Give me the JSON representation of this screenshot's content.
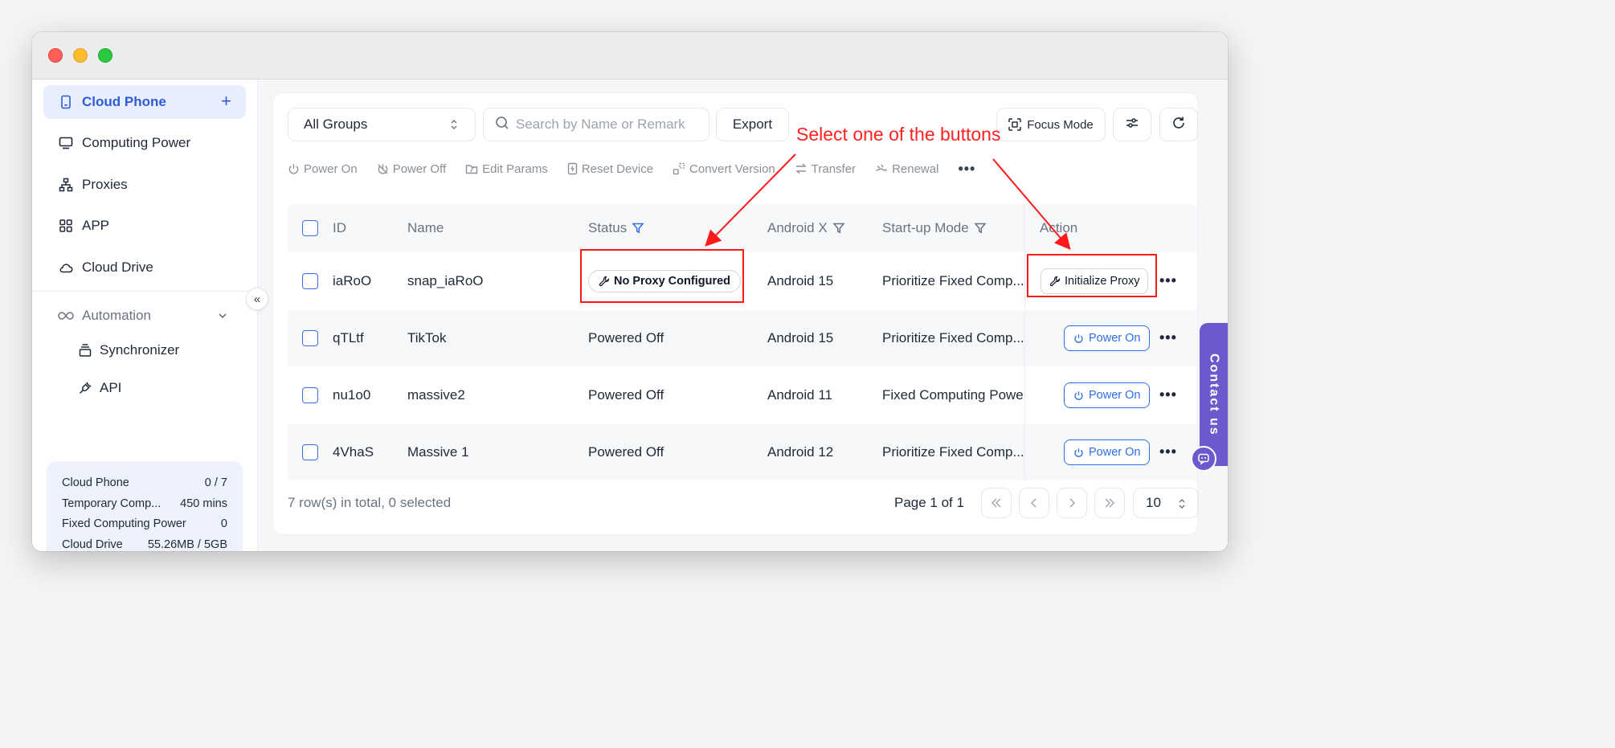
{
  "sidebar": {
    "items": [
      {
        "label": "Cloud Phone",
        "icon": "phone-icon",
        "active": true
      },
      {
        "label": "Computing Power",
        "icon": "monitor-icon"
      },
      {
        "label": "Proxies",
        "icon": "network-icon"
      },
      {
        "label": "APP",
        "icon": "apps-grid-icon"
      },
      {
        "label": "Cloud Drive",
        "icon": "cloud-icon"
      }
    ],
    "add_symbol": "+",
    "automation": {
      "label": "Automation",
      "children": [
        {
          "label": "Synchronizer",
          "icon": "stack-icon"
        },
        {
          "label": "API",
          "icon": "plug-icon"
        }
      ]
    },
    "collapse_symbol": "«",
    "usage": [
      {
        "label": "Cloud Phone",
        "value": "0 / 7"
      },
      {
        "label": "Temporary Comp...",
        "value": "450 mins"
      },
      {
        "label": "Fixed Computing Power",
        "value": "0"
      },
      {
        "label": "Cloud Drive",
        "value": "55.26MB / 5GB"
      }
    ]
  },
  "controls": {
    "group_select": "All Groups",
    "search_placeholder": "Search by Name or Remark",
    "export_label": "Export",
    "focus_mode_label": "Focus Mode"
  },
  "toolbar": [
    {
      "label": "Power On",
      "icon": "power-icon"
    },
    {
      "label": "Power Off",
      "icon": "power-off-icon"
    },
    {
      "label": "Edit Params",
      "icon": "folder-edit-icon"
    },
    {
      "label": "Reset Device",
      "icon": "reset-device-icon"
    },
    {
      "label": "Convert Version",
      "icon": "convert-icon"
    },
    {
      "label": "Transfer",
      "icon": "transfer-icon"
    },
    {
      "label": "Renewal",
      "icon": "renewal-icon"
    }
  ],
  "toolbar_more": "•••",
  "table": {
    "headers": {
      "id": "ID",
      "name": "Name",
      "status": "Status",
      "android": "Android X",
      "mode": "Start-up Mode",
      "action": "Action"
    },
    "rows": [
      {
        "id": "iaRoO",
        "name": "snap_iaRoO",
        "status": "No Proxy Configured",
        "android": "Android 15",
        "mode": "Prioritize Fixed Comp...",
        "action": "Initialize Proxy"
      },
      {
        "id": "qTLtf",
        "name": "TikTok",
        "status": "Powered Off",
        "android": "Android 15",
        "mode": "Prioritize Fixed Comp...",
        "action": "Power On"
      },
      {
        "id": "nu1o0",
        "name": "massive2",
        "status": "Powered Off",
        "android": "Android 11",
        "mode": "Fixed Computing Powe",
        "action": "Power On"
      },
      {
        "id": "4VhaS",
        "name": "Massive 1",
        "status": "Powered Off",
        "android": "Android 12",
        "mode": "Prioritize Fixed Comp...",
        "action": "Power On"
      }
    ],
    "more_symbol": "•••"
  },
  "footer": {
    "summary": "7 row(s) in total, 0 selected",
    "page": "Page 1 of 1",
    "page_size": "10"
  },
  "annotation": {
    "text": "Select one of the buttons",
    "color": "#ff1a1a"
  },
  "contact": {
    "label": "Contact us"
  },
  "colors": {
    "accent": "#2f5bd8",
    "primary_button": "#2f6fe4",
    "contact": "#6a5acd"
  }
}
